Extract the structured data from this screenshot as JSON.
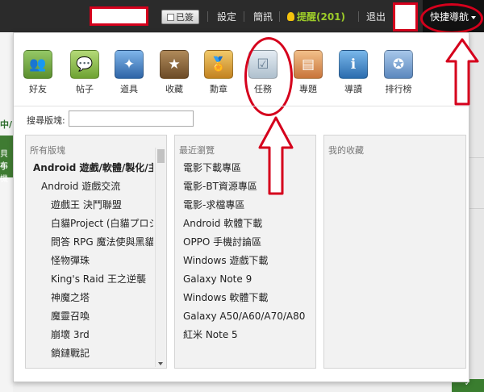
{
  "topbar": {
    "sign_label": "已簽",
    "settings": "設定",
    "messages": "簡訊",
    "reminder": "提醒(201)",
    "logout": "退出",
    "quick_nav": "快捷導航"
  },
  "background_page": {
    "green_text": "中/",
    "box_line1": "貝布",
    "box_line2": "手機"
  },
  "nav_icons": [
    {
      "label": "好友",
      "icon": "friends-icon"
    },
    {
      "label": "帖子",
      "icon": "posts-icon"
    },
    {
      "label": "道具",
      "icon": "tools-icon"
    },
    {
      "label": "收藏",
      "icon": "favorites-icon"
    },
    {
      "label": "勳章",
      "icon": "medal-icon"
    },
    {
      "label": "任務",
      "icon": "task-icon"
    },
    {
      "label": "專題",
      "icon": "topics-icon"
    },
    {
      "label": "導讀",
      "icon": "guide-icon"
    },
    {
      "label": "排行榜",
      "icon": "ranking-icon"
    }
  ],
  "search": {
    "label": "搜尋版塊:",
    "value": ""
  },
  "columns": {
    "all_boards": {
      "header": "所有版塊",
      "items": [
        {
          "label": "Android 遊戲/軟體/製化/主",
          "level": 1
        },
        {
          "label": "Android 遊戲交流",
          "level": 2
        },
        {
          "label": "遊戲王 決鬥聯盟",
          "level": 3
        },
        {
          "label": "白貓Project (白貓プロジ",
          "level": 3
        },
        {
          "label": "問答 RPG 魔法使與黑貓維",
          "level": 3
        },
        {
          "label": "怪物彈珠",
          "level": 3
        },
        {
          "label": "King's Raid 王之逆襲",
          "level": 3
        },
        {
          "label": "神魔之塔",
          "level": 3
        },
        {
          "label": "魔靈召喚",
          "level": 3
        },
        {
          "label": "崩壞 3rd",
          "level": 3
        },
        {
          "label": "鎖鏈戰記",
          "level": 3
        }
      ]
    },
    "recent": {
      "header": "最近瀏覽",
      "items": [
        "電影下載專區",
        "電影-BT資源專區",
        "電影-求檔專區",
        "Android 軟體下載",
        "OPPO 手機討論區",
        "Windows 遊戲下載",
        "Galaxy Note 9",
        "Windows 軟體下載",
        "Galaxy A50/A60/A70/A80",
        "紅米 Note 5"
      ]
    },
    "favorites": {
      "header": "我的收藏",
      "items": []
    }
  },
  "colors": {
    "annotation_red": "#d5001c",
    "topbar_bg": "#2b2b2b",
    "reminder_green": "#9ccb29"
  }
}
